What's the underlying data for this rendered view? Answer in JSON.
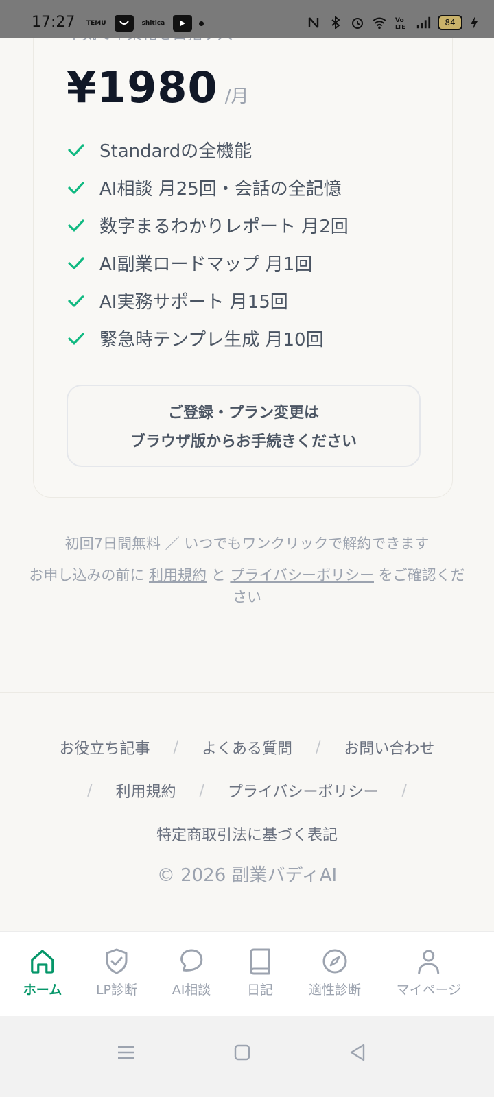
{
  "status_bar": {
    "time": "17:27",
    "apps": [
      "TEMU",
      "",
      "shitica",
      ""
    ],
    "battery": "84"
  },
  "plan": {
    "tagline": "本気で本業化を目指す人へ",
    "price": "¥1980",
    "price_unit": "/月",
    "features": [
      "Standardの全機能",
      "AI相談 月25回・会話の全記憶",
      "数字まるわかりレポート 月2回",
      "AI副業ロードマップ 月1回",
      "AI実務サポート 月15回",
      "緊急時テンプレ生成 月10回"
    ],
    "notice_line1": "ご登録・プラン変更は",
    "notice_line2": "ブラウザ版からお手続きください"
  },
  "notes": {
    "trial": "初回7日間無料 ／ いつでもワンクリックで解約できます",
    "terms_prefix": "お申し込みの前に",
    "terms_link": "利用規約",
    "terms_and": "と",
    "privacy_link": "プライバシーポリシー",
    "terms_suffix": "をご確認ください"
  },
  "footer": {
    "row1": [
      "お役立ち記事",
      "よくある質問",
      "お問い合わせ"
    ],
    "row2": [
      "利用規約",
      "プライバシーポリシー"
    ],
    "row3": "特定商取引法に基づく表記",
    "separator": "/",
    "copyright": "© 2026 副業バディAI"
  },
  "tabs": [
    {
      "label": "ホーム",
      "icon": "home-icon"
    },
    {
      "label": "LP診断",
      "icon": "shield-check-icon"
    },
    {
      "label": "AI相談",
      "icon": "chat-bubble-icon"
    },
    {
      "label": "日記",
      "icon": "book-icon"
    },
    {
      "label": "適性診断",
      "icon": "compass-icon"
    },
    {
      "label": "マイページ",
      "icon": "user-icon"
    }
  ],
  "colors": {
    "accent": "#059669",
    "check": "#10b981",
    "price": "#111827",
    "muted": "#9ca3af"
  }
}
